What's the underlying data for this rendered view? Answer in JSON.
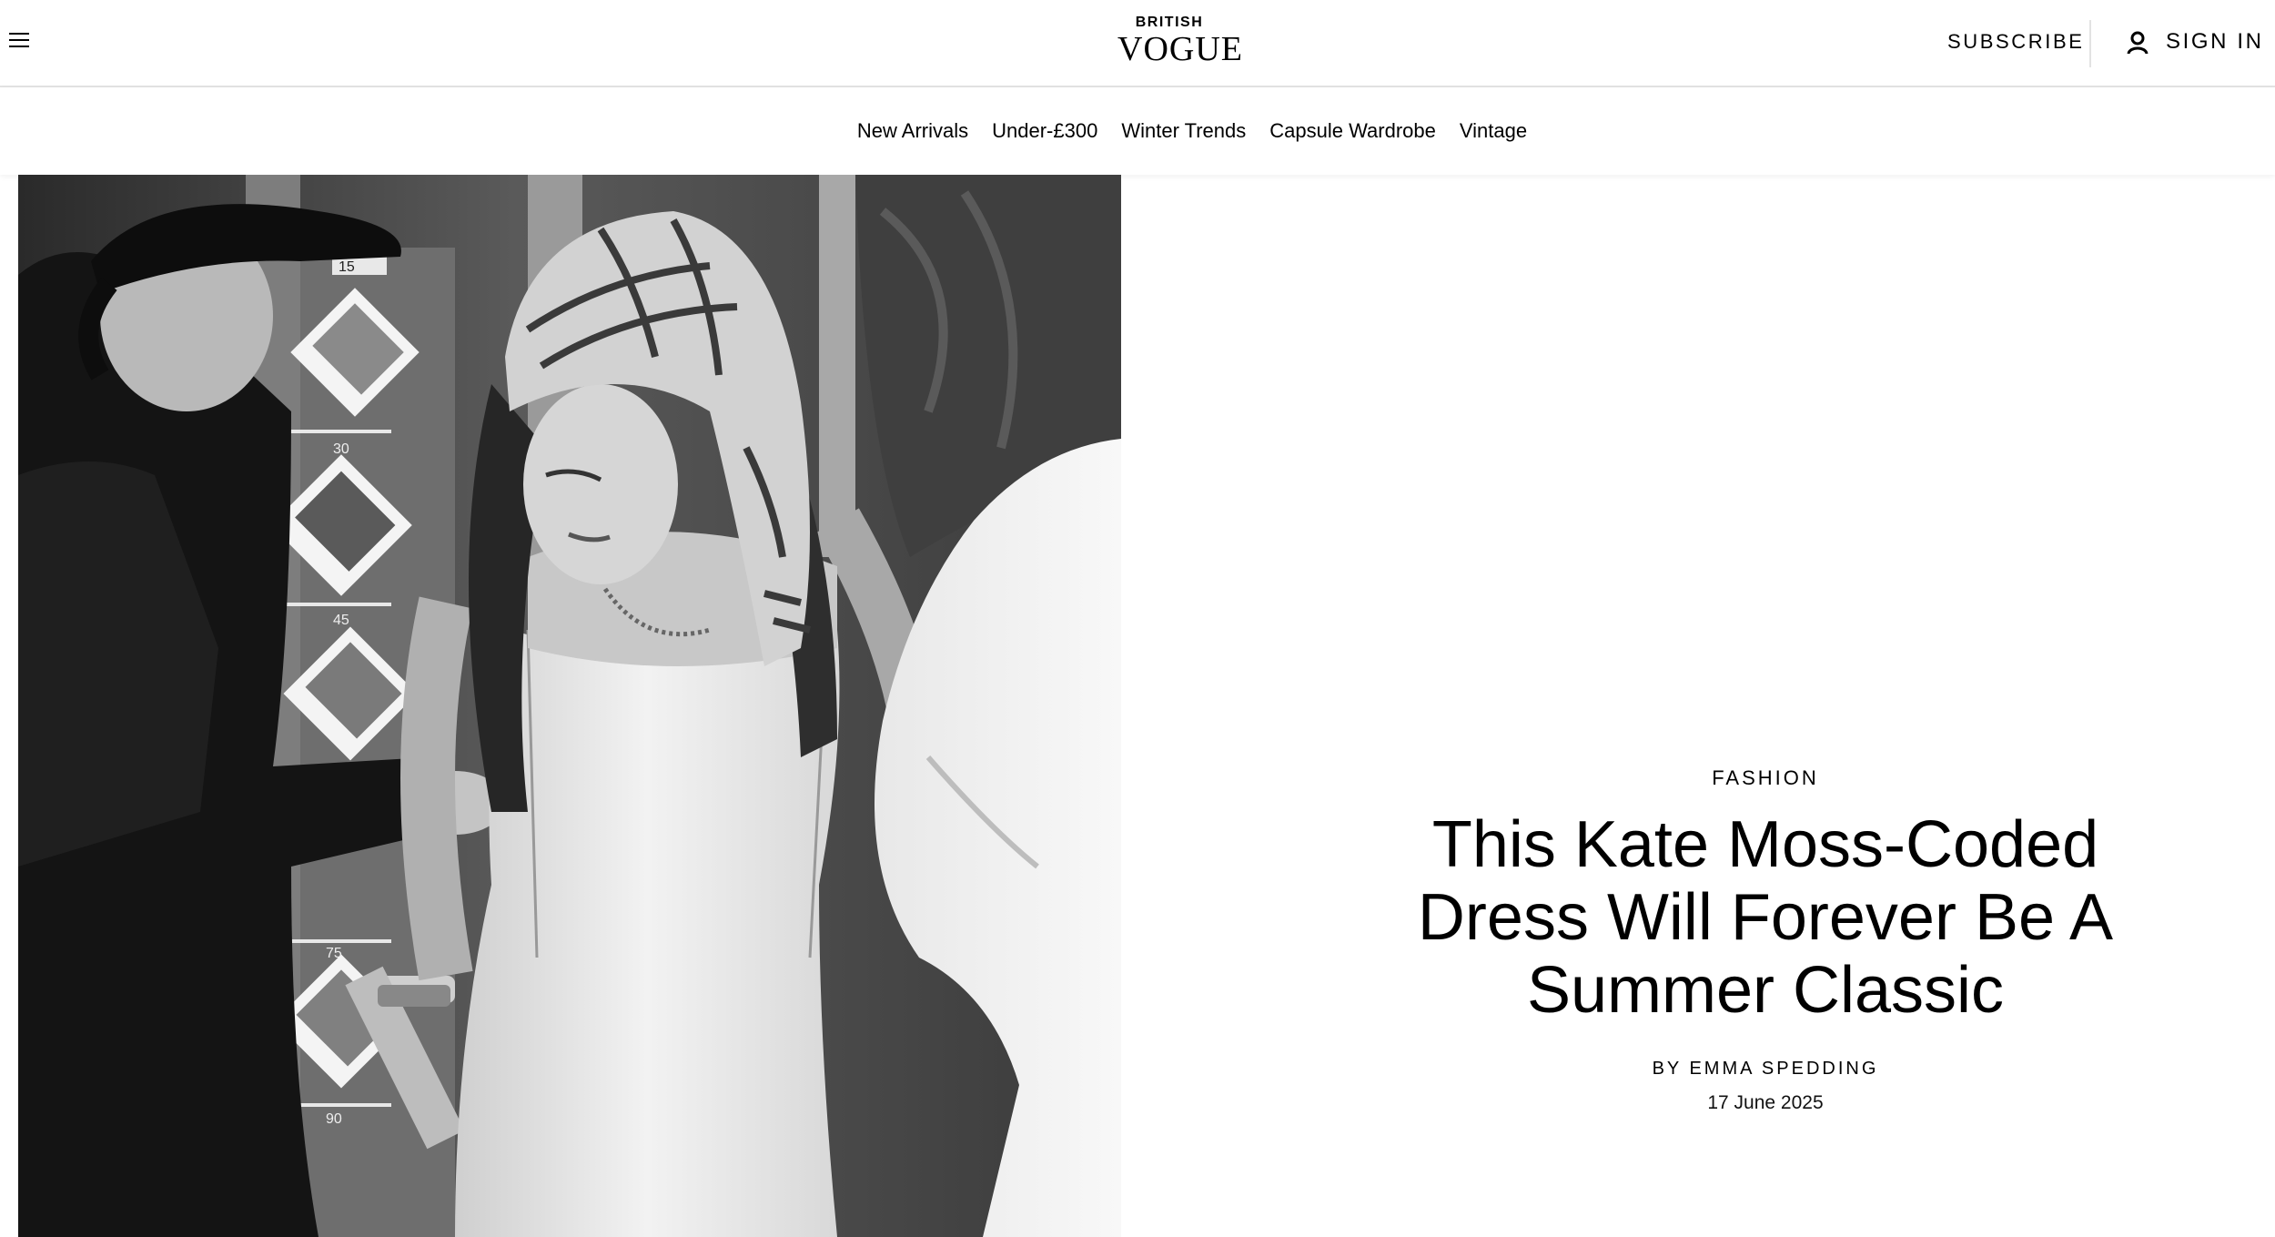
{
  "header": {
    "logo_small": "BRITISH",
    "logo_big": "VOGUE",
    "subscribe_label": "SUBSCRIBE",
    "signin_label": "SIGN IN",
    "menu_icon": "hamburger-menu-icon",
    "user_icon": "user-icon"
  },
  "nav": {
    "items": [
      "New Arrivals",
      "Under-£300",
      "Winter Trends",
      "Capsule Wardrobe",
      "Vintage"
    ]
  },
  "article": {
    "category": "FASHION",
    "headline": "This Kate Moss-Coded Dress Will Forever Be A Summer Classic",
    "byline_prefix": "BY ",
    "author": "EMMA SPEDDING",
    "date": "17 June 2025"
  },
  "hero_image": {
    "description_tag": "black-and-white-backstage-photo",
    "board_numbers": [
      "15",
      "30",
      "45",
      "75",
      "90"
    ]
  },
  "colors": {
    "background": "#ffffff",
    "text": "#000000",
    "divider": "#e3e3e3"
  }
}
